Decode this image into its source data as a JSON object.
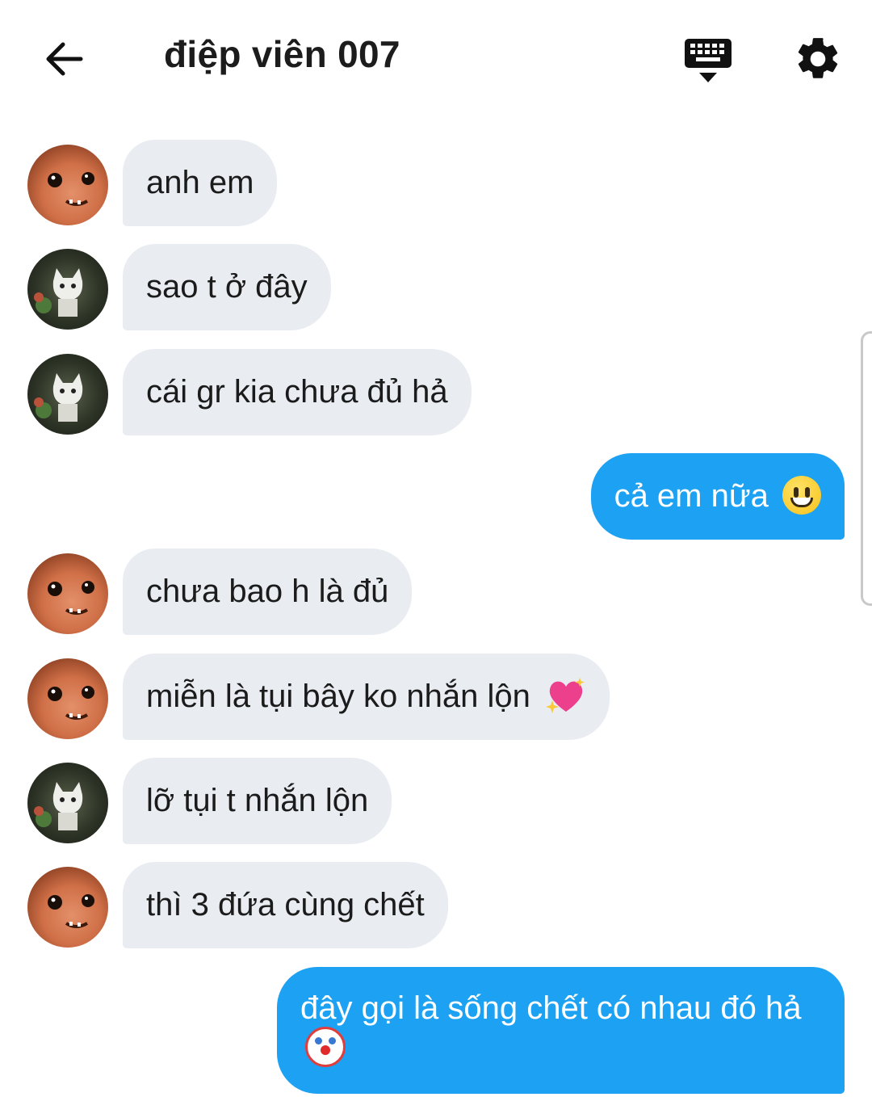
{
  "header": {
    "title": "điệp viên 007",
    "back_icon": "arrow-left-icon",
    "keyboard_icon": "keyboard-icon",
    "settings_icon": "gear-icon"
  },
  "colors": {
    "incoming_bubble": "#e9edf2",
    "outgoing_bubble": "#1da1f2",
    "text": "#1b1b1b"
  },
  "messages": [
    {
      "from": "dog",
      "text": "anh em"
    },
    {
      "from": "cat",
      "text": "sao t ở đây"
    },
    {
      "from": "cat",
      "text": "cái gr kia chưa đủ hả"
    },
    {
      "from": "me",
      "text": "cả em nữa",
      "emoji": "grinning-face-emoji"
    },
    {
      "from": "dog",
      "text": "chưa bao h là đủ"
    },
    {
      "from": "dog",
      "text": "miễn là tụi bây ko nhắn lộn",
      "emoji": "sparkling-heart-emoji"
    },
    {
      "from": "cat",
      "text": "lỡ tụi t nhắn lộn"
    },
    {
      "from": "dog",
      "text": "thì 3 đứa cùng chết"
    },
    {
      "from": "me",
      "text": "đây gọi là sống chết có nhau đó hả",
      "emoji": "clown-face-emoji"
    }
  ]
}
